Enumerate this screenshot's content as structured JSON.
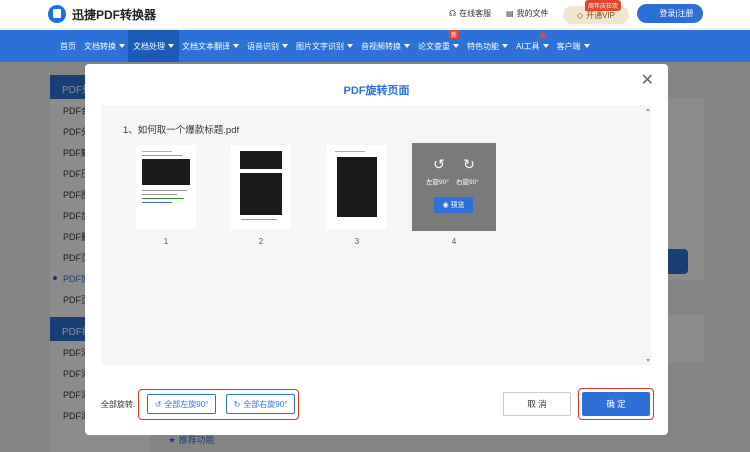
{
  "app": {
    "title": "迅捷PDF转换器"
  },
  "topbar": {
    "support": "在线客服",
    "my_files": "我的文件",
    "vip_badge": "周年庆狂欢",
    "vip": "开通VIP",
    "login": "登录|注册"
  },
  "nav": {
    "items": [
      "首页",
      "文档转换",
      "文档处理",
      "文档文本翻译",
      "语音识别",
      "图片文字识别",
      "音视频转换",
      "论文查重",
      "特色功能",
      "AI工具",
      "客户端"
    ],
    "new_tag": "新"
  },
  "sidebar": {
    "head1": "PDF处",
    "items1": [
      "PDF合",
      "PDF分",
      "PDF解",
      "PDF压",
      "PDF图",
      "PDF加",
      "PDF删",
      "PDF页",
      "PDF旋",
      "PDF页"
    ],
    "head2": "PDF编",
    "items2": [
      "PDF添",
      "PDF添",
      "PDF添",
      "PDF添加文字"
    ]
  },
  "background": {
    "feature_title": "推荐功能"
  },
  "modal": {
    "title": "PDF旋转页面",
    "file_name": "1、如何取一个爆款标题.pdf",
    "pages": [
      "1",
      "2",
      "3",
      "4"
    ],
    "rotate_left_label": "左旋90°",
    "rotate_right_label": "右旋90°",
    "preview_label": "预览",
    "rotate_all_label": "全部旋转:",
    "rotate_all_left": "全部左旋90°",
    "rotate_all_right": "全部右旋90°",
    "cancel": "取 消",
    "confirm": "确 定"
  }
}
